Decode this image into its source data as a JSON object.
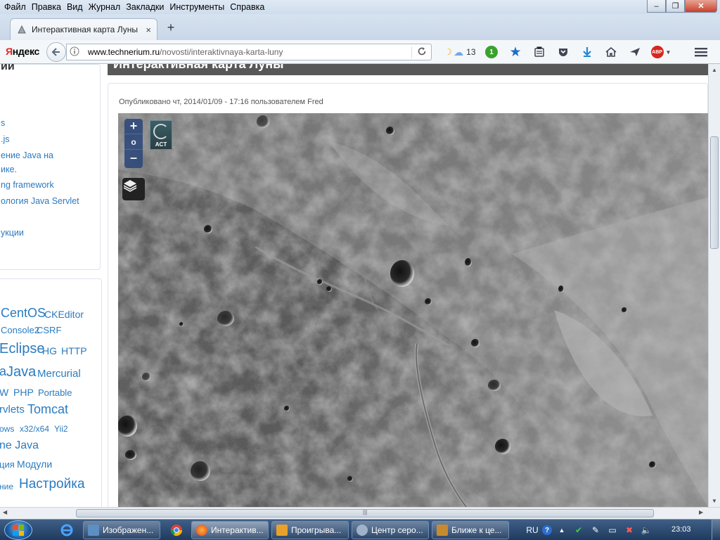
{
  "menubar": {
    "items": [
      {
        "label": "Файл"
      },
      {
        "label": "Правка"
      },
      {
        "label": "Вид"
      },
      {
        "label": "Журнал"
      },
      {
        "label": "Закладки"
      },
      {
        "label": "Инструменты"
      },
      {
        "label": "Справка"
      }
    ]
  },
  "window_controls": {
    "minimize": "–",
    "maximize": "❐",
    "close": "✕"
  },
  "tab": {
    "title": "Интерактивная карта Луны",
    "close": "×",
    "new_tab": "+"
  },
  "navbar": {
    "yandex_first": "Я",
    "yandex_rest": "ндекс",
    "url_host": "www.technerium.ru",
    "url_path": "/novosti/interaktivnaya-karta-luny",
    "weather_temp": "13",
    "notification_count": "1",
    "adblock_label": "ABP"
  },
  "sidebar": {
    "heading": "ии",
    "links": [
      {
        "label": "s"
      },
      {
        "label": ".js"
      },
      {
        "label": "ение Java на"
      },
      {
        "label": "ике."
      },
      {
        "label": "ng framework"
      },
      {
        "label": "ология Java Servlet"
      },
      {
        "label": "укции"
      }
    ],
    "tags": [
      {
        "label": "CentOS"
      },
      {
        "label": "CKEditor"
      },
      {
        "label": "Console2"
      },
      {
        "label": "CSRF"
      },
      {
        "label": "Eclipse"
      },
      {
        "label": "HG"
      },
      {
        "label": "HTTP"
      },
      {
        "label": "a"
      },
      {
        "label": "Java"
      },
      {
        "label": "Mercurial"
      },
      {
        "label": "W"
      },
      {
        "label": "PHP"
      },
      {
        "label": "Portable"
      },
      {
        "label": "rvlets"
      },
      {
        "label": "Tomcat"
      },
      {
        "label": "ows"
      },
      {
        "label": "x32/x64"
      },
      {
        "label": "Yii2"
      },
      {
        "label": "ne Java"
      },
      {
        "label": "ция"
      },
      {
        "label": "Модули"
      },
      {
        "label": "ние"
      },
      {
        "label": "Настройка"
      }
    ]
  },
  "article": {
    "title": "Интерактивная карта Луны",
    "meta": "Опубликовано чт, 2014/01/09 - 17:16 пользователем Fred"
  },
  "map": {
    "zoom_in": "+",
    "zoom_reset": "o",
    "zoom_out": "–",
    "logo_text": "ACT"
  },
  "taskbar": {
    "tasks": [
      {
        "label": "Изображен..."
      },
      {
        "label": "Интерактив..."
      },
      {
        "label": "Проигрыва..."
      },
      {
        "label": "Центр серо..."
      },
      {
        "label": "Ближе к це..."
      }
    ],
    "lang": "RU",
    "clock": "23:03"
  }
}
